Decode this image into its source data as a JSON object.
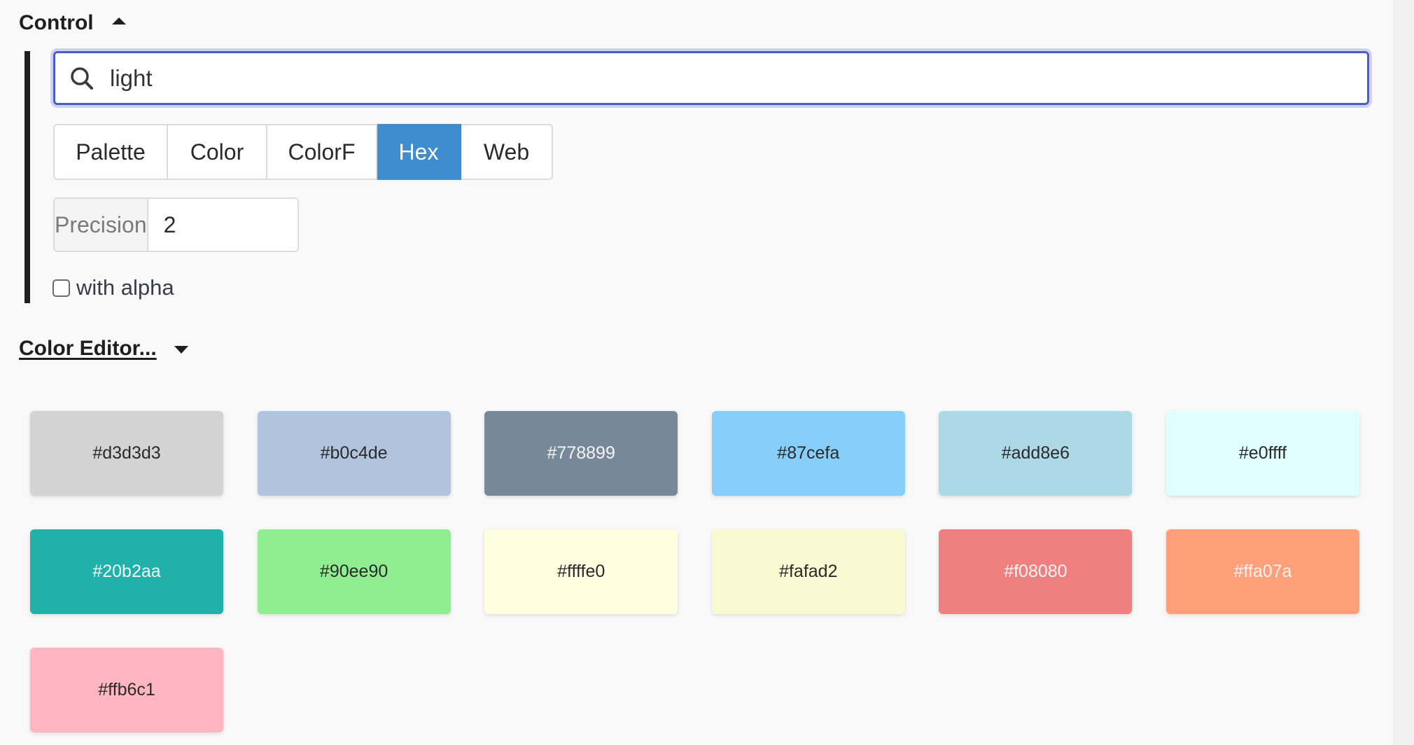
{
  "control": {
    "heading": "Control",
    "expanded": true,
    "search": {
      "value": "light",
      "placeholder": ""
    },
    "format_buttons": [
      {
        "label": "Palette",
        "active": false
      },
      {
        "label": "Color",
        "active": false
      },
      {
        "label": "ColorF",
        "active": false
      },
      {
        "label": "Hex",
        "active": true
      },
      {
        "label": "Web",
        "active": false
      }
    ],
    "precision": {
      "label": "Precision",
      "value": "2"
    },
    "with_alpha": {
      "label": "with alpha",
      "checked": false
    }
  },
  "editor": {
    "heading": "Color Editor...",
    "expanded": false
  },
  "colors": {
    "accent": "#3f8dcf",
    "focus_border": "#4a5fc1"
  },
  "swatches": [
    {
      "hex": "#d3d3d3",
      "text_color": "#2a2a2a"
    },
    {
      "hex": "#b0c4de",
      "text_color": "#2a2a2a"
    },
    {
      "hex": "#778899",
      "text_color": "#f4f4f4"
    },
    {
      "hex": "#87cefa",
      "text_color": "#2a2a2a"
    },
    {
      "hex": "#add8e6",
      "text_color": "#2a2a2a"
    },
    {
      "hex": "#e0ffff",
      "text_color": "#2a2a2a"
    },
    {
      "hex": "#20b2aa",
      "text_color": "#f4f4f4"
    },
    {
      "hex": "#90ee90",
      "text_color": "#2a2a2a"
    },
    {
      "hex": "#ffffe0",
      "text_color": "#2a2a2a"
    },
    {
      "hex": "#fafad2",
      "text_color": "#2a2a2a"
    },
    {
      "hex": "#f08080",
      "text_color": "#f4f4f4"
    },
    {
      "hex": "#ffa07a",
      "text_color": "#f4f4f4"
    },
    {
      "hex": "#ffb6c1",
      "text_color": "#2a2a2a"
    }
  ]
}
